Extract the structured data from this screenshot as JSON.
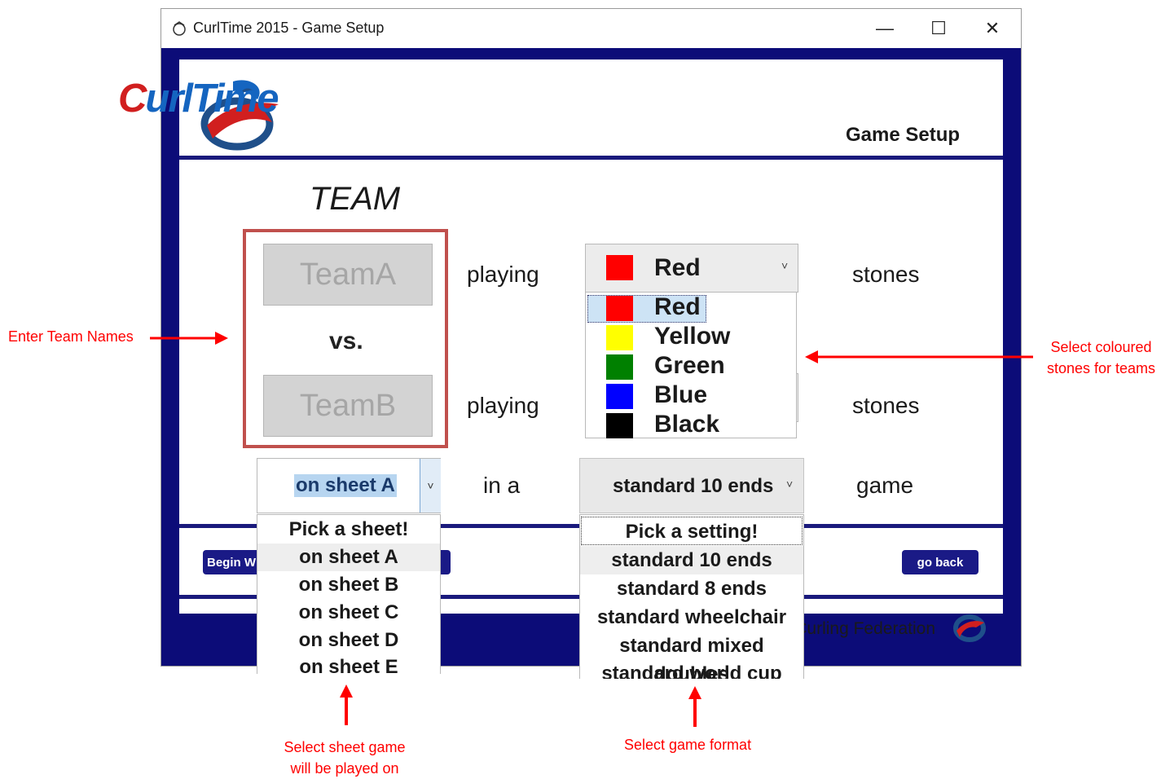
{
  "window": {
    "title": "CurlTime 2015 - Game Setup",
    "minimize_glyph": "—",
    "maximize_glyph": "☐",
    "close_glyph": "✕"
  },
  "header": {
    "logo_text_c": "C",
    "logo_text_rest": "urlTime",
    "section_title": "Game Setup"
  },
  "form": {
    "team_heading": "TEAM",
    "team_a_placeholder": "TeamA",
    "team_b_placeholder": "TeamB",
    "vs_label": "vs.",
    "playing_label": "playing",
    "stones_label": "stones",
    "in_a_label": "in a",
    "game_label": "game"
  },
  "stones_dropdown": {
    "selected": {
      "name": "Red",
      "color": "#ff0000"
    },
    "arrow": "˅",
    "options": [
      {
        "name": "Red",
        "color": "#ff0000"
      },
      {
        "name": "Yellow",
        "color": "#ffff00"
      },
      {
        "name": "Green",
        "color": "#008000"
      },
      {
        "name": "Blue",
        "color": "#0000ff"
      },
      {
        "name": "Black",
        "color": "#000000"
      }
    ]
  },
  "sheet_dropdown": {
    "selected": "on sheet A",
    "arrow": "˅",
    "options": [
      "Pick a sheet!",
      "on sheet A",
      "on sheet B",
      "on sheet C",
      "on sheet D",
      "on sheet E"
    ]
  },
  "format_dropdown": {
    "selected": "standard 10 ends",
    "arrow": "˅",
    "options": [
      "Pick a setting!",
      "standard 10 ends",
      "standard 8 ends",
      "standard wheelchair",
      "standard mixed doubles",
      "standard world cup"
    ]
  },
  "footer": {
    "begin_button_partial": "Begin W",
    "go_back_button": "go back",
    "federation_text": "Curling Federation"
  },
  "annotations": {
    "team_names": "Enter Team Names",
    "stones_line1": "Select coloured",
    "stones_line2": "stones for teams",
    "sheet_line1": "Select sheet game",
    "sheet_line2": "will be played on",
    "format": "Select game format"
  },
  "colors": {
    "frame": "#0c0c78",
    "annotation": "#ff0000",
    "highlight_box": "#c0504d",
    "button": "#1a1a86"
  }
}
